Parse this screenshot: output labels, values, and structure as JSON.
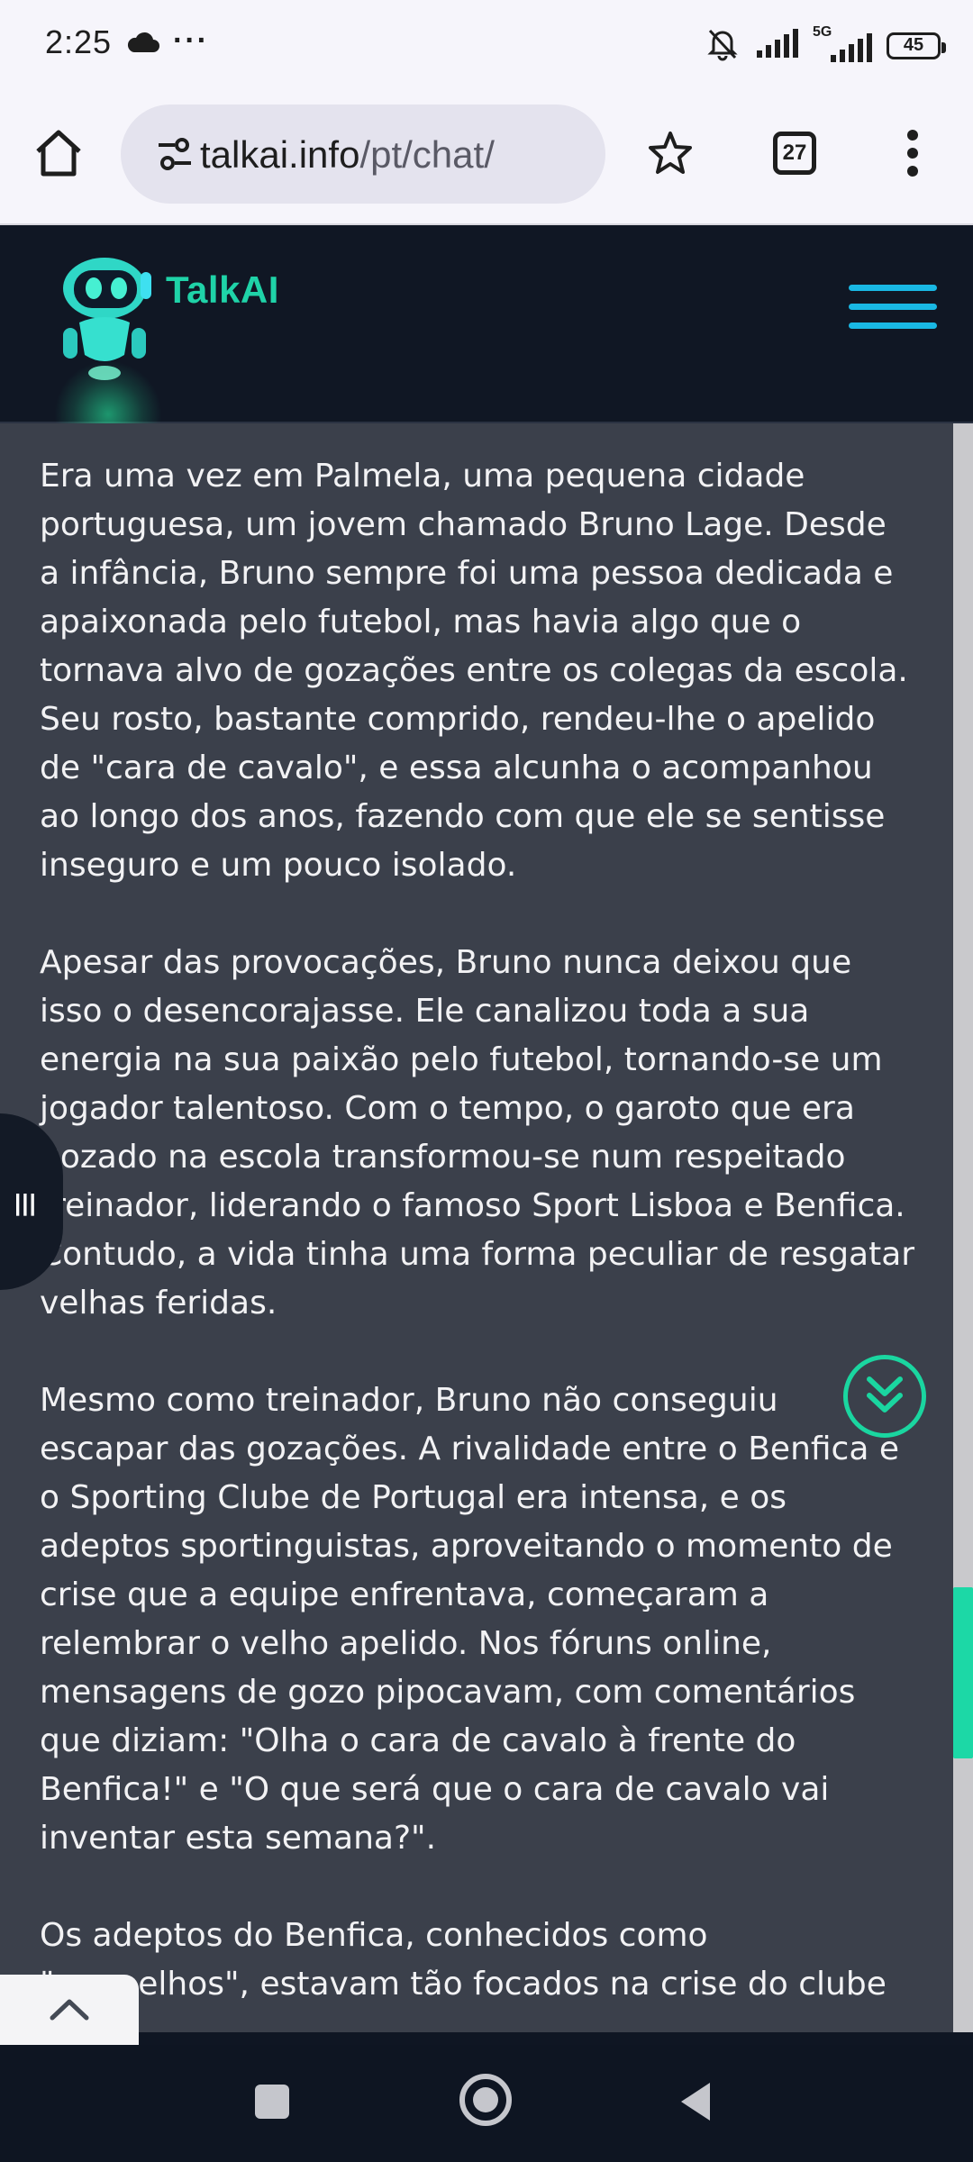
{
  "status_bar": {
    "time": "2:25",
    "overflow": "···",
    "network": "5G",
    "battery": "45",
    "icons": [
      "cloud-icon",
      "mute-bell-icon",
      "signal-icon",
      "5g-signal-icon",
      "battery-icon"
    ]
  },
  "browser": {
    "url_domain": "talkai.info",
    "url_path": "/pt/chat/",
    "tab_count": "27",
    "icons": [
      "home-icon",
      "site-settings-icon",
      "star-icon",
      "more-vert-icon"
    ]
  },
  "site": {
    "brand": "TalkAI",
    "brand_color": "#1fd3a8",
    "menu_color": "#19b8e4"
  },
  "story": {
    "paragraphs": [
      "Era uma vez em Palmela, uma pequena cidade portuguesa, um jovem chamado Bruno Lage. Desde a infância, Bruno sempre foi uma pessoa dedicada e apaixonada pelo futebol, mas havia algo que o tornava alvo de gozações entre os colegas da escola. Seu rosto, bastante comprido, rendeu-lhe o apelido de \"cara de cavalo\", e essa alcunha o acompanhou ao longo dos anos, fazendo com que ele se sentisse inseguro e um pouco isolado.",
      "Apesar das provocações, Bruno nunca deixou que isso o desencorajasse. Ele canalizou toda a sua energia na sua paixão pelo futebol, tornando-se um jogador talentoso. Com o tempo, o garoto que era gozado na escola transformou-se num respeitado treinador, liderando o famoso Sport Lisboa e Benfica. Contudo, a vida tinha uma forma peculiar de resgatar velhas feridas.",
      "Mesmo como treinador, Bruno não conseguiu escapar das gozações. A rivalidade entre o Benfica e o Sporting Clube de Portugal era intensa, e os adeptos sportinguistas, aproveitando o momento de crise que a equipe enfrentava, começaram a relembrar o velho apelido. Nos fóruns online, mensagens de gozo pipocavam, com comentários que diziam: \"Olha o cara de cavalo à frente do Benfica!\" e \"O que será que o cara de cavalo vai inventar esta semana?\".",
      "Os adeptos do Benfica, conhecidos como \"vermelhos\", estavam tão focados na crise do clube"
    ]
  },
  "controls": {
    "side_handle": "|||",
    "accent_color": "#1ad6a0"
  }
}
